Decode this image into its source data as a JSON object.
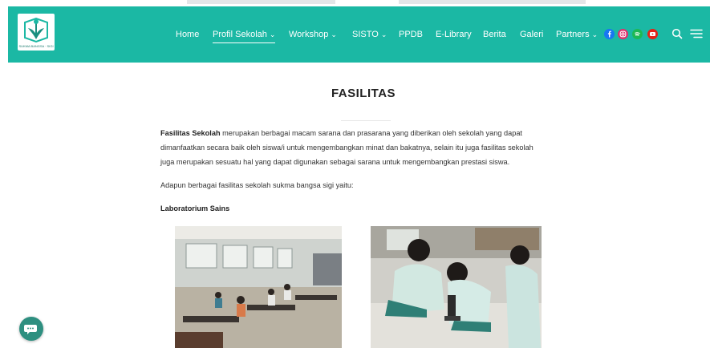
{
  "brand": {
    "logo_caption": "SUKMA BANGSA · SIGI"
  },
  "nav": {
    "items": [
      {
        "label": "Home",
        "dropdown": false,
        "active": false
      },
      {
        "label": "Profil Sekolah",
        "dropdown": true,
        "active": true
      },
      {
        "label": "Workshop",
        "dropdown": true,
        "active": false
      },
      {
        "label": "SISTO",
        "dropdown": true,
        "active": false
      },
      {
        "label": "PPDB",
        "dropdown": false,
        "active": false
      },
      {
        "label": "E-Library",
        "dropdown": false,
        "active": false
      },
      {
        "label": "Berita",
        "dropdown": false,
        "active": false
      },
      {
        "label": "Galeri",
        "dropdown": false,
        "active": false
      },
      {
        "label": "Partners",
        "dropdown": true,
        "active": false
      }
    ],
    "social": [
      {
        "icon": "facebook-icon",
        "color": "#1877f2"
      },
      {
        "icon": "instagram-icon",
        "color": "#e1306c"
      },
      {
        "icon": "spotify-icon",
        "color": "#1db954"
      },
      {
        "icon": "youtube-icon",
        "color": "#e62117"
      }
    ]
  },
  "page": {
    "title": "FASILITAS",
    "intro_bold": "Fasilitas Sekolah",
    "intro_line1": " merupakan berbagai macam sarana dan prasarana yang diberikan oleh sekolah yang dapat",
    "intro_line2": "dimanfaatkan secara baik oleh siswa/i untuk mengembangkan minat dan bakatnya, selain itu juga fasilitas sekolah",
    "intro_line3": "juga merupakan sesuatu hal yang dapat digunakan sebagai sarana untuk mengembangkan prestasi siswa.",
    "list_intro": "Adapun berbagai fasilitas sekolah sukma bangsa sigi yaitu:",
    "section_heading": "Laboratorium Sains"
  },
  "colors": {
    "header": "#1bb8a4",
    "chat_button": "#2e8f80"
  }
}
